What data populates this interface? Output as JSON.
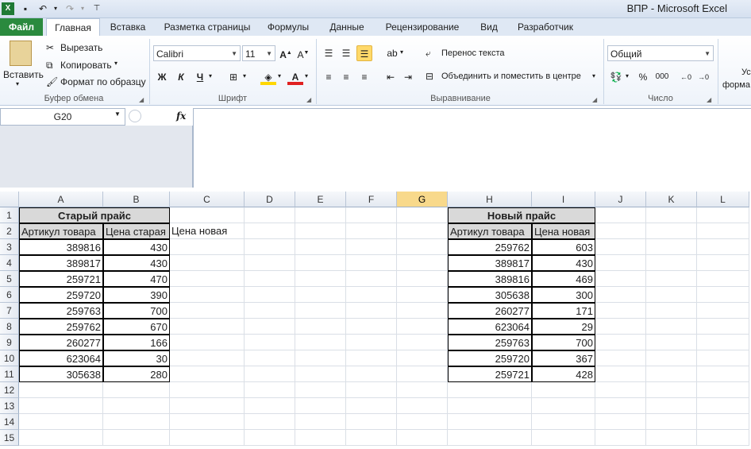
{
  "window": {
    "title": "ВПР  -  Microsoft Excel"
  },
  "tabs": [
    "Главная",
    "Вставка",
    "Разметка страницы",
    "Формулы",
    "Данные",
    "Рецензирование",
    "Вид",
    "Разработчик"
  ],
  "file_tab": "Файл",
  "clipboard": {
    "paste": "Вставить",
    "cut": "Вырезать",
    "copy": "Копировать",
    "format_painter": "Формат по образцу",
    "label": "Буфер обмена"
  },
  "font": {
    "name": "Calibri",
    "size": "11",
    "bold": "Ж",
    "italic": "К",
    "underline": "Ч",
    "label": "Шрифт"
  },
  "alignment": {
    "wrap": "Перенос текста",
    "merge": "Объединить и поместить в центре",
    "label": "Выравнивание"
  },
  "number": {
    "format": "Общий",
    "percent": "%",
    "thousands": "000",
    "label": "Число"
  },
  "styles": {
    "partial": "Ус",
    "partial2": "форма"
  },
  "formula_bar": {
    "name_box": "G20",
    "fx": "fx",
    "value": ""
  },
  "columns": [
    "A",
    "B",
    "C",
    "D",
    "E",
    "F",
    "G",
    "H",
    "I",
    "J",
    "K",
    "L"
  ],
  "selected_column": "G",
  "rows": [
    "1",
    "2",
    "3",
    "4",
    "5",
    "6",
    "7",
    "8",
    "9",
    "10",
    "11",
    "12",
    "13",
    "14",
    "15"
  ],
  "old_price": {
    "title": "Старый прайс",
    "headers": [
      "Артикул товара",
      "Цена старая",
      "Цена новая"
    ],
    "rows": [
      [
        "389816",
        "430"
      ],
      [
        "389817",
        "430"
      ],
      [
        "259721",
        "470"
      ],
      [
        "259720",
        "390"
      ],
      [
        "259763",
        "700"
      ],
      [
        "259762",
        "670"
      ],
      [
        "260277",
        "166"
      ],
      [
        "623064",
        "30"
      ],
      [
        "305638",
        "280"
      ]
    ]
  },
  "new_price": {
    "title": "Новый прайс",
    "headers": [
      "Артикул товара",
      "Цена новая"
    ],
    "rows": [
      [
        "259762",
        "603"
      ],
      [
        "389817",
        "430"
      ],
      [
        "389816",
        "469"
      ],
      [
        "305638",
        "300"
      ],
      [
        "260277",
        "171"
      ],
      [
        "623064",
        "29"
      ],
      [
        "259763",
        "700"
      ],
      [
        "259720",
        "367"
      ],
      [
        "259721",
        "428"
      ]
    ]
  },
  "colors": {
    "file_tab": "#2a8a3e",
    "header_fill": "#d9d9d9",
    "selected_header": "#f8d98b"
  }
}
